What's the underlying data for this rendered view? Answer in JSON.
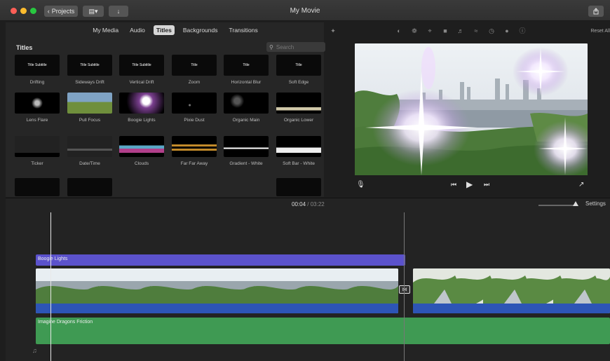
{
  "window": {
    "title": "My Movie",
    "projects_label": "Projects"
  },
  "browser": {
    "tabs": [
      {
        "label": "My Media",
        "active": false
      },
      {
        "label": "Audio",
        "active": false
      },
      {
        "label": "Titles",
        "active": true
      },
      {
        "label": "Backgrounds",
        "active": false
      },
      {
        "label": "Transitions",
        "active": false
      }
    ],
    "section_title": "Titles",
    "search_placeholder": "Search",
    "tiles": [
      {
        "label": "Drifting",
        "thumb_text": "Title Subtitle"
      },
      {
        "label": "Sideways Drift",
        "thumb_text": "Title Subtitle"
      },
      {
        "label": "Vertical Drift",
        "thumb_text": "Title Subtitle"
      },
      {
        "label": "Zoom",
        "thumb_text": "Title"
      },
      {
        "label": "Horizontal Blur",
        "thumb_text": "Title"
      },
      {
        "label": "Soft Edge",
        "thumb_text": "Title"
      },
      {
        "label": "Lens Flare",
        "thumb_text": ""
      },
      {
        "label": "Pull Focus",
        "thumb_text": ""
      },
      {
        "label": "Boogie Lights",
        "thumb_text": ""
      },
      {
        "label": "Pixie Dust",
        "thumb_text": ""
      },
      {
        "label": "Organic Main",
        "thumb_text": ""
      },
      {
        "label": "Organic Lower",
        "thumb_text": ""
      },
      {
        "label": "Ticker",
        "thumb_text": ""
      },
      {
        "label": "Date/Time",
        "thumb_text": ""
      },
      {
        "label": "Clouds",
        "thumb_text": ""
      },
      {
        "label": "Far Far Away",
        "thumb_text": ""
      },
      {
        "label": "Gradient - White",
        "thumb_text": ""
      },
      {
        "label": "Soft Bar - White",
        "thumb_text": ""
      },
      {
        "label": "",
        "thumb_text": ""
      },
      {
        "label": "",
        "thumb_text": ""
      },
      {
        "label": "",
        "thumb_text": ""
      },
      {
        "label": "",
        "thumb_text": ""
      },
      {
        "label": "",
        "thumb_text": ""
      },
      {
        "label": "",
        "thumb_text": ""
      }
    ]
  },
  "viewer": {
    "reset_all_label": "Reset All",
    "toolbar_icons": [
      "color-balance-icon",
      "color-correction-icon",
      "crop-icon",
      "stabilization-icon",
      "volume-icon",
      "noise-reduction-icon",
      "speed-icon",
      "filter-icon",
      "info-icon"
    ]
  },
  "timeline": {
    "current_time": "00:04",
    "separator": "/",
    "total_time": "03:22",
    "settings_label": "Settings",
    "title_clip": "Boogie Lights",
    "audio_clip": "Imagine Dragons Friction"
  },
  "colors": {
    "title_clip": "#5b52cc",
    "video_clip_bar": "#2d55b6",
    "audio_clip": "#3f9a53",
    "active_tab": "#d6d6d6"
  }
}
